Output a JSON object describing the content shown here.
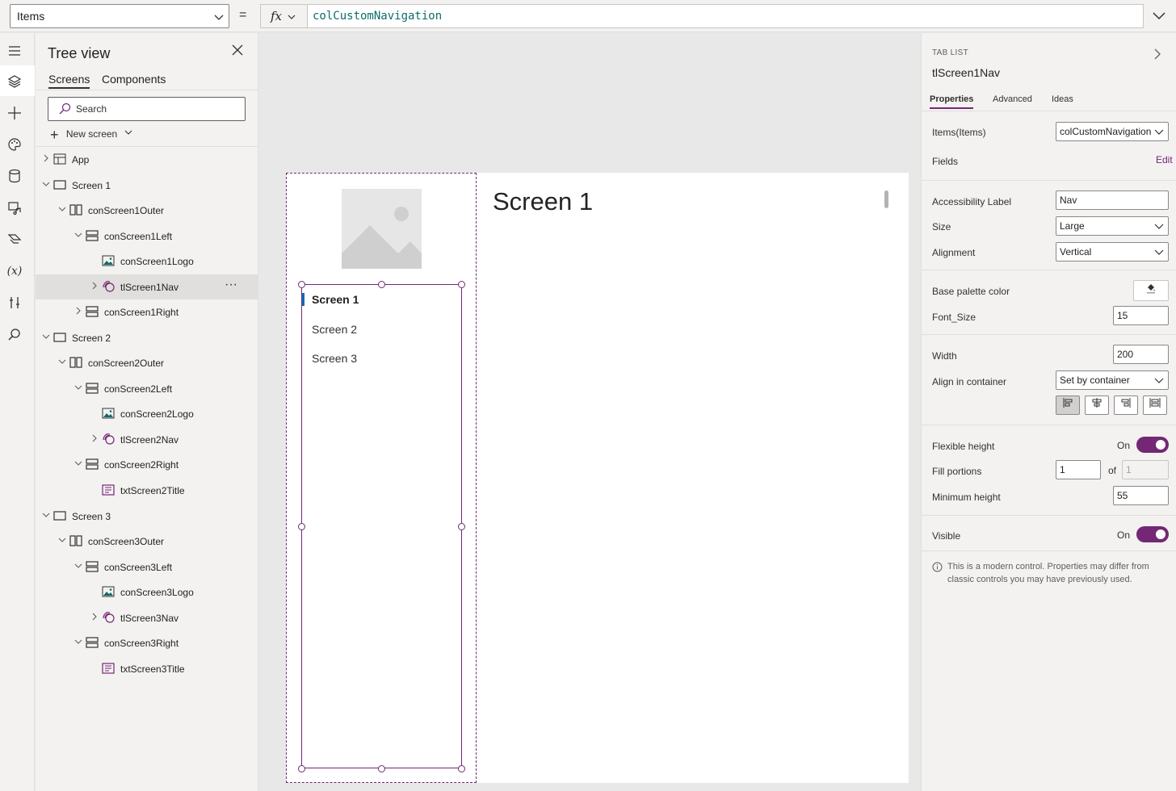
{
  "formula_bar": {
    "property": "Items",
    "equals": "=",
    "fx": "fx",
    "formula": "colCustomNavigation"
  },
  "rail": {
    "icons": [
      "hamburger-icon",
      "layers-icon",
      "plus-icon",
      "palette-icon",
      "database-icon",
      "media-icon",
      "power-automate-icon",
      "variables-icon",
      "tools-icon",
      "search-icon"
    ],
    "variables_label": "(x)"
  },
  "tree": {
    "title": "Tree view",
    "tabs": [
      "Screens",
      "Components"
    ],
    "search_placeholder": "Search",
    "new_screen": "New screen",
    "nodes": [
      {
        "label": "App",
        "icon": "app-icon"
      },
      {
        "label": "Screen 1",
        "icon": "screen-icon"
      },
      {
        "label": "conScreen1Outer",
        "icon": "horizontal-container-icon"
      },
      {
        "label": "conScreen1Left",
        "icon": "vertical-container-icon"
      },
      {
        "label": "conScreen1Logo",
        "icon": "image-icon"
      },
      {
        "label": "tlScreen1Nav",
        "icon": "tab-list-icon",
        "more": "···"
      },
      {
        "label": "conScreen1Right",
        "icon": "vertical-container-icon"
      },
      {
        "label": "Screen 2",
        "icon": "screen-icon"
      },
      {
        "label": "conScreen2Outer",
        "icon": "horizontal-container-icon"
      },
      {
        "label": "conScreen2Left",
        "icon": "vertical-container-icon"
      },
      {
        "label": "conScreen2Logo",
        "icon": "image-icon"
      },
      {
        "label": "tlScreen2Nav",
        "icon": "tab-list-icon"
      },
      {
        "label": "conScreen2Right",
        "icon": "vertical-container-icon"
      },
      {
        "label": "txtScreen2Title",
        "icon": "text-icon"
      },
      {
        "label": "Screen 3",
        "icon": "screen-icon"
      },
      {
        "label": "conScreen3Outer",
        "icon": "horizontal-container-icon"
      },
      {
        "label": "conScreen3Left",
        "icon": "vertical-container-icon"
      },
      {
        "label": "conScreen3Logo",
        "icon": "image-icon"
      },
      {
        "label": "tlScreen3Nav",
        "icon": "tab-list-icon"
      },
      {
        "label": "conScreen3Right",
        "icon": "vertical-container-icon"
      },
      {
        "label": "txtScreen3Title",
        "icon": "text-icon"
      }
    ]
  },
  "canvas": {
    "nav_items": [
      "Screen 1",
      "Screen 2",
      "Screen 3"
    ],
    "title": "Screen 1"
  },
  "props": {
    "type": "TAB LIST",
    "name": "tlScreen1Nav",
    "tabs": [
      "Properties",
      "Advanced",
      "Ideas"
    ],
    "items_label": "Items(Items)",
    "items_value": "colCustomNavigation",
    "fields_label": "Fields",
    "fields_edit": "Edit",
    "accessibility_label": "Accessibility Label",
    "accessibility_value": "Nav",
    "size_label": "Size",
    "size_value": "Large",
    "alignment_label": "Alignment",
    "alignment_value": "Vertical",
    "palette_label": "Base palette color",
    "font_size_label": "Font_Size",
    "font_size_value": "15",
    "width_label": "Width",
    "width_value": "200",
    "align_container_label": "Align in container",
    "align_container_value": "Set by container",
    "flex_height_label": "Flexible height",
    "flex_height_state": "On",
    "fill_portions_label": "Fill portions",
    "fill_portions_value": "1",
    "fill_of": "of",
    "fill_total": "1",
    "min_height_label": "Minimum height",
    "min_height_value": "55",
    "visible_label": "Visible",
    "visible_state": "On",
    "info": "This is a modern control. Properties may differ from classic controls you may have previously used.",
    "accent_color": "#742774"
  }
}
